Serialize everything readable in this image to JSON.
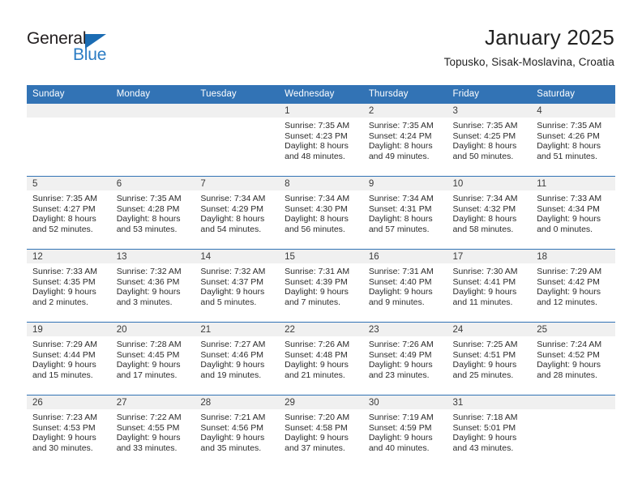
{
  "brand": {
    "name_top": "General",
    "name_bottom": "Blue",
    "accent_color": "#2b7cc4",
    "triangle_color": "#1b6cb3"
  },
  "header": {
    "title": "January 2025",
    "subtitle": "Topusko, Sisak-Moslavina, Croatia"
  },
  "calendar": {
    "header_bg": "#3273b5",
    "daynum_bg": "#f0f0f0",
    "weekday_headers": [
      "Sunday",
      "Monday",
      "Tuesday",
      "Wednesday",
      "Thursday",
      "Friday",
      "Saturday"
    ],
    "weeks": [
      [
        {
          "day": "",
          "sunrise": "",
          "sunset": "",
          "daylight1": "",
          "daylight2": ""
        },
        {
          "day": "",
          "sunrise": "",
          "sunset": "",
          "daylight1": "",
          "daylight2": ""
        },
        {
          "day": "",
          "sunrise": "",
          "sunset": "",
          "daylight1": "",
          "daylight2": ""
        },
        {
          "day": "1",
          "sunrise": "Sunrise: 7:35 AM",
          "sunset": "Sunset: 4:23 PM",
          "daylight1": "Daylight: 8 hours",
          "daylight2": "and 48 minutes."
        },
        {
          "day": "2",
          "sunrise": "Sunrise: 7:35 AM",
          "sunset": "Sunset: 4:24 PM",
          "daylight1": "Daylight: 8 hours",
          "daylight2": "and 49 minutes."
        },
        {
          "day": "3",
          "sunrise": "Sunrise: 7:35 AM",
          "sunset": "Sunset: 4:25 PM",
          "daylight1": "Daylight: 8 hours",
          "daylight2": "and 50 minutes."
        },
        {
          "day": "4",
          "sunrise": "Sunrise: 7:35 AM",
          "sunset": "Sunset: 4:26 PM",
          "daylight1": "Daylight: 8 hours",
          "daylight2": "and 51 minutes."
        }
      ],
      [
        {
          "day": "5",
          "sunrise": "Sunrise: 7:35 AM",
          "sunset": "Sunset: 4:27 PM",
          "daylight1": "Daylight: 8 hours",
          "daylight2": "and 52 minutes."
        },
        {
          "day": "6",
          "sunrise": "Sunrise: 7:35 AM",
          "sunset": "Sunset: 4:28 PM",
          "daylight1": "Daylight: 8 hours",
          "daylight2": "and 53 minutes."
        },
        {
          "day": "7",
          "sunrise": "Sunrise: 7:34 AM",
          "sunset": "Sunset: 4:29 PM",
          "daylight1": "Daylight: 8 hours",
          "daylight2": "and 54 minutes."
        },
        {
          "day": "8",
          "sunrise": "Sunrise: 7:34 AM",
          "sunset": "Sunset: 4:30 PM",
          "daylight1": "Daylight: 8 hours",
          "daylight2": "and 56 minutes."
        },
        {
          "day": "9",
          "sunrise": "Sunrise: 7:34 AM",
          "sunset": "Sunset: 4:31 PM",
          "daylight1": "Daylight: 8 hours",
          "daylight2": "and 57 minutes."
        },
        {
          "day": "10",
          "sunrise": "Sunrise: 7:34 AM",
          "sunset": "Sunset: 4:32 PM",
          "daylight1": "Daylight: 8 hours",
          "daylight2": "and 58 minutes."
        },
        {
          "day": "11",
          "sunrise": "Sunrise: 7:33 AM",
          "sunset": "Sunset: 4:34 PM",
          "daylight1": "Daylight: 9 hours",
          "daylight2": "and 0 minutes."
        }
      ],
      [
        {
          "day": "12",
          "sunrise": "Sunrise: 7:33 AM",
          "sunset": "Sunset: 4:35 PM",
          "daylight1": "Daylight: 9 hours",
          "daylight2": "and 2 minutes."
        },
        {
          "day": "13",
          "sunrise": "Sunrise: 7:32 AM",
          "sunset": "Sunset: 4:36 PM",
          "daylight1": "Daylight: 9 hours",
          "daylight2": "and 3 minutes."
        },
        {
          "day": "14",
          "sunrise": "Sunrise: 7:32 AM",
          "sunset": "Sunset: 4:37 PM",
          "daylight1": "Daylight: 9 hours",
          "daylight2": "and 5 minutes."
        },
        {
          "day": "15",
          "sunrise": "Sunrise: 7:31 AM",
          "sunset": "Sunset: 4:39 PM",
          "daylight1": "Daylight: 9 hours",
          "daylight2": "and 7 minutes."
        },
        {
          "day": "16",
          "sunrise": "Sunrise: 7:31 AM",
          "sunset": "Sunset: 4:40 PM",
          "daylight1": "Daylight: 9 hours",
          "daylight2": "and 9 minutes."
        },
        {
          "day": "17",
          "sunrise": "Sunrise: 7:30 AM",
          "sunset": "Sunset: 4:41 PM",
          "daylight1": "Daylight: 9 hours",
          "daylight2": "and 11 minutes."
        },
        {
          "day": "18",
          "sunrise": "Sunrise: 7:29 AM",
          "sunset": "Sunset: 4:42 PM",
          "daylight1": "Daylight: 9 hours",
          "daylight2": "and 12 minutes."
        }
      ],
      [
        {
          "day": "19",
          "sunrise": "Sunrise: 7:29 AM",
          "sunset": "Sunset: 4:44 PM",
          "daylight1": "Daylight: 9 hours",
          "daylight2": "and 15 minutes."
        },
        {
          "day": "20",
          "sunrise": "Sunrise: 7:28 AM",
          "sunset": "Sunset: 4:45 PM",
          "daylight1": "Daylight: 9 hours",
          "daylight2": "and 17 minutes."
        },
        {
          "day": "21",
          "sunrise": "Sunrise: 7:27 AM",
          "sunset": "Sunset: 4:46 PM",
          "daylight1": "Daylight: 9 hours",
          "daylight2": "and 19 minutes."
        },
        {
          "day": "22",
          "sunrise": "Sunrise: 7:26 AM",
          "sunset": "Sunset: 4:48 PM",
          "daylight1": "Daylight: 9 hours",
          "daylight2": "and 21 minutes."
        },
        {
          "day": "23",
          "sunrise": "Sunrise: 7:26 AM",
          "sunset": "Sunset: 4:49 PM",
          "daylight1": "Daylight: 9 hours",
          "daylight2": "and 23 minutes."
        },
        {
          "day": "24",
          "sunrise": "Sunrise: 7:25 AM",
          "sunset": "Sunset: 4:51 PM",
          "daylight1": "Daylight: 9 hours",
          "daylight2": "and 25 minutes."
        },
        {
          "day": "25",
          "sunrise": "Sunrise: 7:24 AM",
          "sunset": "Sunset: 4:52 PM",
          "daylight1": "Daylight: 9 hours",
          "daylight2": "and 28 minutes."
        }
      ],
      [
        {
          "day": "26",
          "sunrise": "Sunrise: 7:23 AM",
          "sunset": "Sunset: 4:53 PM",
          "daylight1": "Daylight: 9 hours",
          "daylight2": "and 30 minutes."
        },
        {
          "day": "27",
          "sunrise": "Sunrise: 7:22 AM",
          "sunset": "Sunset: 4:55 PM",
          "daylight1": "Daylight: 9 hours",
          "daylight2": "and 33 minutes."
        },
        {
          "day": "28",
          "sunrise": "Sunrise: 7:21 AM",
          "sunset": "Sunset: 4:56 PM",
          "daylight1": "Daylight: 9 hours",
          "daylight2": "and 35 minutes."
        },
        {
          "day": "29",
          "sunrise": "Sunrise: 7:20 AM",
          "sunset": "Sunset: 4:58 PM",
          "daylight1": "Daylight: 9 hours",
          "daylight2": "and 37 minutes."
        },
        {
          "day": "30",
          "sunrise": "Sunrise: 7:19 AM",
          "sunset": "Sunset: 4:59 PM",
          "daylight1": "Daylight: 9 hours",
          "daylight2": "and 40 minutes."
        },
        {
          "day": "31",
          "sunrise": "Sunrise: 7:18 AM",
          "sunset": "Sunset: 5:01 PM",
          "daylight1": "Daylight: 9 hours",
          "daylight2": "and 43 minutes."
        },
        {
          "day": "",
          "sunrise": "",
          "sunset": "",
          "daylight1": "",
          "daylight2": ""
        }
      ]
    ]
  }
}
